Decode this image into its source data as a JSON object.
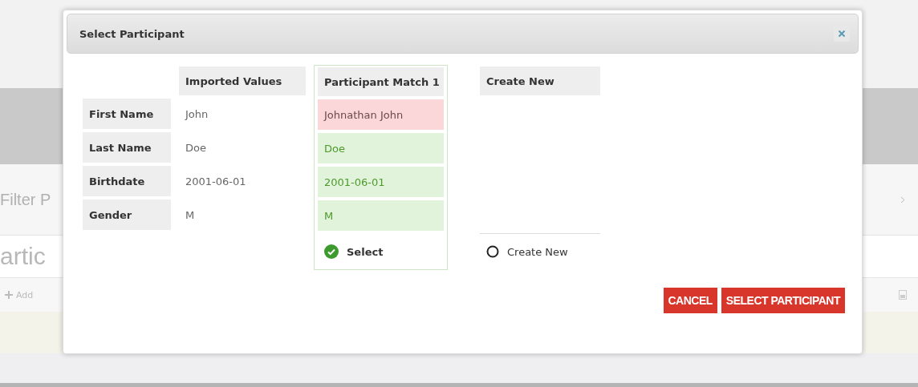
{
  "background": {
    "filter_label": "Filter P",
    "heading": "artic",
    "add_label": "Add"
  },
  "dialog": {
    "title": "Select Participant",
    "columns": [
      "Imported Values",
      "Participant Match 1",
      "Create New"
    ],
    "rows": [
      {
        "label": "First Name",
        "imported": "John",
        "match": "Johnathan John",
        "matches": false
      },
      {
        "label": "Last Name",
        "imported": "Doe",
        "match": "Doe",
        "matches": true
      },
      {
        "label": "Birthdate",
        "imported": "2001-06-01",
        "match": "2001-06-01",
        "matches": true
      },
      {
        "label": "Gender",
        "imported": "M",
        "match": "M",
        "matches": true
      }
    ],
    "options": [
      {
        "label": "Select",
        "selected": true
      },
      {
        "label": "Create New",
        "selected": false
      }
    ],
    "buttons": [
      "CANCEL",
      "SELECT PARTICIPANT"
    ]
  }
}
